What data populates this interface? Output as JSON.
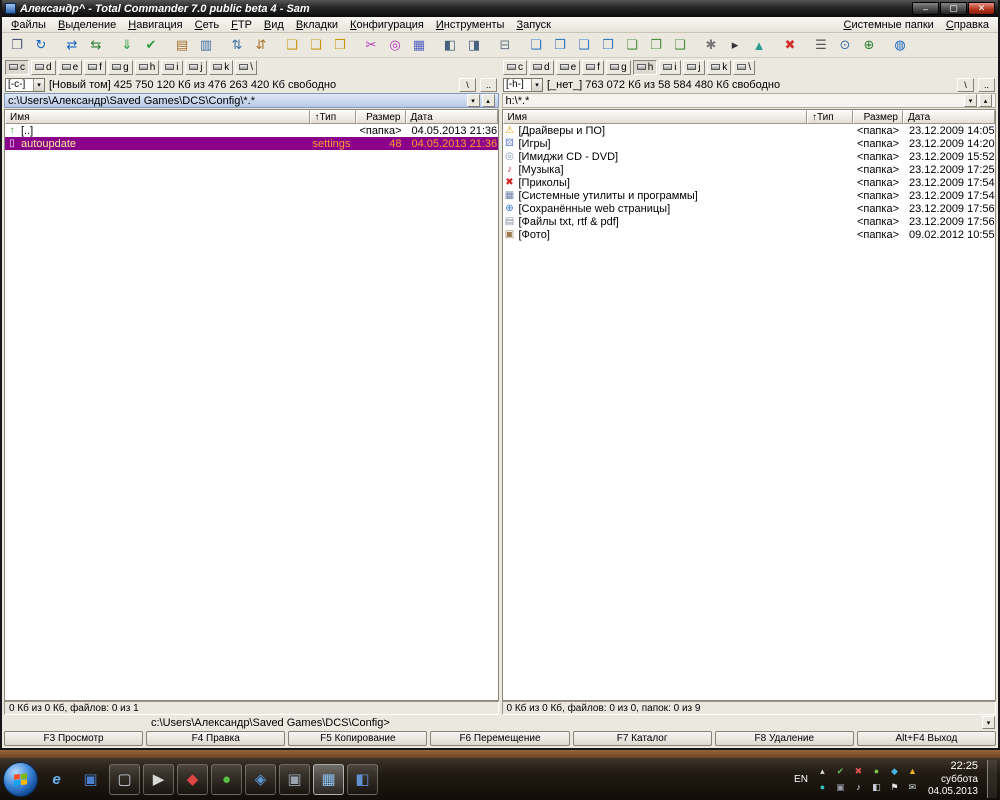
{
  "window": {
    "title": "Александр^ - Total Commander 7.0 public beta 4 - Sam",
    "caption": {
      "minimize": "–",
      "maximize": "▢",
      "close": "✕"
    }
  },
  "menu": {
    "items": [
      "Файлы",
      "Выделение",
      "Навигация",
      "Сеть",
      "FTP",
      "Вид",
      "Вкладки",
      "Конфигурация",
      "Инструменты",
      "Запуск"
    ],
    "right_items": [
      "Системные папки",
      "Справка"
    ]
  },
  "toolbar": {
    "icons": [
      {
        "name": "attributes",
        "glyph": "❐",
        "color": "#4a5a78"
      },
      {
        "name": "refresh",
        "glyph": "↻",
        "color": "#1565c0"
      },
      {
        "name": "ftp-connect",
        "glyph": "⇄",
        "color": "#1565c0"
      },
      {
        "name": "ftp-disconnect",
        "glyph": "⇆",
        "color": "#2e7d32"
      },
      {
        "name": "download",
        "glyph": "⇓",
        "color": "#2e9d42"
      },
      {
        "name": "verify",
        "glyph": "✔",
        "color": "#2e9d42"
      },
      {
        "name": "notes",
        "glyph": "▤",
        "color": "#a8742c"
      },
      {
        "name": "list-view",
        "glyph": "▥",
        "color": "#3a6ea5"
      },
      {
        "name": "sort-asc",
        "glyph": "⇅",
        "color": "#3a6ea5"
      },
      {
        "name": "sort-desc",
        "glyph": "⇵",
        "color": "#a8742c"
      },
      {
        "name": "new-folder",
        "glyph": "❏",
        "color": "#c79810"
      },
      {
        "name": "favorites-folder",
        "glyph": "❑",
        "color": "#c79810"
      },
      {
        "name": "parent-folder",
        "glyph": "❒",
        "color": "#c79810"
      },
      {
        "name": "cut",
        "glyph": "✂",
        "color": "#b535b5"
      },
      {
        "name": "search",
        "glyph": "◎",
        "color": "#b535b5"
      },
      {
        "name": "calculator",
        "glyph": "▦",
        "color": "#5560c0"
      },
      {
        "name": "brief-view",
        "glyph": "◧",
        "color": "#46627f"
      },
      {
        "name": "full-view",
        "glyph": "◨",
        "color": "#46627f"
      },
      {
        "name": "tree-view",
        "glyph": "⊟",
        "color": "#667788"
      },
      {
        "name": "folder-documents",
        "glyph": "❏",
        "color": "#3a7abf"
      },
      {
        "name": "folder-pictures",
        "glyph": "❐",
        "color": "#3a7abf"
      },
      {
        "name": "folder-music",
        "glyph": "❑",
        "color": "#3a7abf"
      },
      {
        "name": "folder-video",
        "glyph": "❒",
        "color": "#3a7abf"
      },
      {
        "name": "folder-downloads",
        "glyph": "❏",
        "color": "#4a8f3f"
      },
      {
        "name": "folder-desktop",
        "glyph": "❐",
        "color": "#4a8f3f"
      },
      {
        "name": "folder-network",
        "glyph": "❑",
        "color": "#4a8f3f"
      },
      {
        "name": "tools",
        "glyph": "✱",
        "color": "#777777"
      },
      {
        "name": "terminal",
        "glyph": "▸",
        "color": "#333333"
      },
      {
        "name": "chart",
        "glyph": "▲",
        "color": "#2a9d8f"
      },
      {
        "name": "delete",
        "glyph": "✖",
        "color": "#d32f2f"
      },
      {
        "name": "options",
        "glyph": "☰",
        "color": "#555555"
      },
      {
        "name": "target",
        "glyph": "⊙",
        "color": "#3a6ea5"
      },
      {
        "name": "add",
        "glyph": "⊕",
        "color": "#2e7d32"
      },
      {
        "name": "globe",
        "glyph": "◍",
        "color": "#1565c0"
      }
    ]
  },
  "drive_bars": {
    "letters": [
      "c",
      "d",
      "e",
      "f",
      "g",
      "h",
      "i",
      "j",
      "k",
      "\\"
    ]
  },
  "glyphs": {
    "combo_arrow": "▾",
    "history": "▾",
    "favorites": "▴",
    "cmd_dropdown": "▾",
    "drive_root": "\\",
    "drive_up": ".."
  },
  "columns": {
    "name": "Имя",
    "type": "↑Тип",
    "size": "Размер",
    "date": "Дата"
  },
  "left_panel": {
    "drive": "[-c-]",
    "info": "[Новый том]  425 750 120 Кб из 476 263 420 Кб свободно",
    "path": "c:\\Users\\Александр\\Saved Games\\DCS\\Config\\*.*",
    "files": [
      {
        "icon": "↑",
        "icon_color": "#1f9d1f",
        "name": "[..]",
        "type": "",
        "size": "<папка>",
        "date": "04.05.2013 21:36"
      },
      {
        "icon": "▯",
        "icon_color": "#e6e6ff",
        "name": "autoupdate",
        "type": "settings",
        "size": "48",
        "date": "04.05.2013 21:36"
      }
    ],
    "selection": {
      "bg": "#8b008b",
      "name_color": "#ffef9e",
      "info_color": "#ff9c2e"
    },
    "status": "0 Кб из 0 Кб, файлов: 0 из 1"
  },
  "right_panel": {
    "drive": "[-h-]",
    "info": "[_нет_]  763 072 Кб из 58 584 480 Кб свободно",
    "path": "h:\\*.*",
    "files": [
      {
        "icon": "⚠",
        "icon_color": "#e8a000",
        "name": "[Драйверы и ПО]",
        "size": "<папка>",
        "date": "23.12.2009 14:05"
      },
      {
        "icon": "⚄",
        "icon_color": "#5577cc",
        "name": "[Игры]",
        "size": "<папка>",
        "date": "23.12.2009 14:20"
      },
      {
        "icon": "◎",
        "icon_color": "#7d8fae",
        "name": "[Имиджи CD - DVD]",
        "size": "<папка>",
        "date": "23.12.2009 15:52"
      },
      {
        "icon": "♪",
        "icon_color": "#c43a4b",
        "name": "[Музыка]",
        "size": "<папка>",
        "date": "23.12.2009 17:25"
      },
      {
        "icon": "✖",
        "icon_color": "#d42222",
        "name": "[Приколы]",
        "size": "<папка>",
        "date": "23.12.2009 17:54"
      },
      {
        "icon": "▦",
        "icon_color": "#6f82a8",
        "name": "[Системные утилиты и программы]",
        "size": "<папка>",
        "date": "23.12.2009 17:54"
      },
      {
        "icon": "⊕",
        "icon_color": "#2a6fd0",
        "name": "[Сохранённые web страницы]",
        "size": "<папка>",
        "date": "23.12.2009 17:56"
      },
      {
        "icon": "▤",
        "icon_color": "#8a94a8",
        "name": "[Файлы txt, rtf & pdf]",
        "size": "<папка>",
        "date": "23.12.2009 17:56"
      },
      {
        "icon": "▣",
        "icon_color": "#9a7a50",
        "name": "[Фото]",
        "size": "<папка>",
        "date": "09.02.2012 10:55"
      }
    ],
    "status": "0 Кб из 0 Кб, файлов: 0 из 0, папок: 0 из 9"
  },
  "command_line": {
    "prompt": "c:\\Users\\Александр\\Saved Games\\DCS\\Config>"
  },
  "function_keys": [
    "F3 Просмотр",
    "F4 Правка",
    "F5 Копирование",
    "F6 Перемещение",
    "F7 Каталог",
    "F8 Удаление",
    "Alt+F4 Выход"
  ],
  "taskbar": {
    "apps": [
      {
        "name": "internet-explorer",
        "glyph": "e",
        "color": "#6ab4f0"
      },
      {
        "name": "floppy-save",
        "glyph": "▣",
        "color": "#4a7fd0"
      },
      {
        "name": "app-window",
        "glyph": "▢",
        "color": "#ccd2d8"
      },
      {
        "name": "media-player",
        "glyph": "▶",
        "color": "#d8d8d8"
      },
      {
        "name": "opera-browser",
        "glyph": "◆",
        "color": "#e04545"
      },
      {
        "name": "green-app",
        "glyph": "●",
        "color": "#58c040"
      },
      {
        "name": "word",
        "glyph": "◈",
        "color": "#5a9bd8"
      },
      {
        "name": "gray-app",
        "glyph": "▣",
        "color": "#9aa4b0"
      },
      {
        "name": "total-commander",
        "glyph": "▦",
        "color": "#8ac0f0"
      },
      {
        "name": "blue-app",
        "glyph": "◧",
        "color": "#6090d0"
      }
    ],
    "tray": {
      "language": "EN",
      "row1": [
        {
          "glyph": "▴",
          "color": "#d8d8d8"
        },
        {
          "glyph": "✔",
          "color": "#5cb85c"
        },
        {
          "glyph": "✖",
          "color": "#e05050"
        },
        {
          "glyph": "●",
          "color": "#7cc24a"
        },
        {
          "glyph": "◆",
          "color": "#4ab0e0"
        },
        {
          "glyph": "▲",
          "color": "#f0b429"
        }
      ],
      "row2": [
        {
          "glyph": "●",
          "color": "#30c0c0"
        },
        {
          "glyph": "▣",
          "color": "#98a0ac"
        },
        {
          "glyph": "♪",
          "color": "#e8e8e8"
        },
        {
          "glyph": "◧",
          "color": "#c8d0d8"
        },
        {
          "glyph": "⚑",
          "color": "#e8e8e8"
        },
        {
          "glyph": "✉",
          "color": "#d0d8e0"
        }
      ],
      "time": "22:25",
      "day": "суббота",
      "date": "04.05.2013"
    }
  }
}
